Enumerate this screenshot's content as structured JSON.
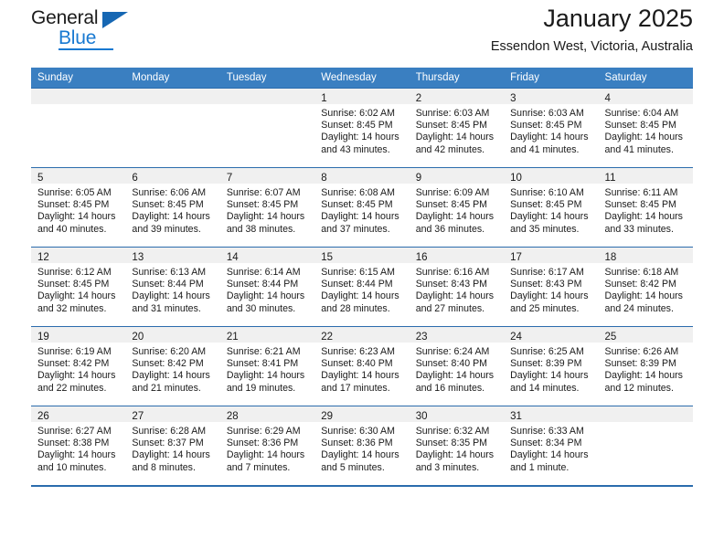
{
  "logo": {
    "word1": "General",
    "word2": "Blue",
    "triangle_color": "#1667b3",
    "blue_color": "#1879d1"
  },
  "header": {
    "title": "January 2025",
    "subtitle": "Essendon West, Victoria, Australia"
  },
  "theme": {
    "header_row_bg": "#3a7fc1",
    "row_divider": "#2b6cad",
    "daynum_band_bg": "#f0f0f0"
  },
  "calendar": {
    "day_headers": [
      "Sunday",
      "Monday",
      "Tuesday",
      "Wednesday",
      "Thursday",
      "Friday",
      "Saturday"
    ],
    "weeks": [
      [
        {
          "day": "",
          "sunrise": "",
          "sunset": "",
          "daylight1": "",
          "daylight2": "",
          "empty": true
        },
        {
          "day": "",
          "sunrise": "",
          "sunset": "",
          "daylight1": "",
          "daylight2": "",
          "empty": true
        },
        {
          "day": "",
          "sunrise": "",
          "sunset": "",
          "daylight1": "",
          "daylight2": "",
          "empty": true
        },
        {
          "day": "1",
          "sunrise": "Sunrise: 6:02 AM",
          "sunset": "Sunset: 8:45 PM",
          "daylight1": "Daylight: 14 hours",
          "daylight2": "and 43 minutes."
        },
        {
          "day": "2",
          "sunrise": "Sunrise: 6:03 AM",
          "sunset": "Sunset: 8:45 PM",
          "daylight1": "Daylight: 14 hours",
          "daylight2": "and 42 minutes."
        },
        {
          "day": "3",
          "sunrise": "Sunrise: 6:03 AM",
          "sunset": "Sunset: 8:45 PM",
          "daylight1": "Daylight: 14 hours",
          "daylight2": "and 41 minutes."
        },
        {
          "day": "4",
          "sunrise": "Sunrise: 6:04 AM",
          "sunset": "Sunset: 8:45 PM",
          "daylight1": "Daylight: 14 hours",
          "daylight2": "and 41 minutes."
        }
      ],
      [
        {
          "day": "5",
          "sunrise": "Sunrise: 6:05 AM",
          "sunset": "Sunset: 8:45 PM",
          "daylight1": "Daylight: 14 hours",
          "daylight2": "and 40 minutes."
        },
        {
          "day": "6",
          "sunrise": "Sunrise: 6:06 AM",
          "sunset": "Sunset: 8:45 PM",
          "daylight1": "Daylight: 14 hours",
          "daylight2": "and 39 minutes."
        },
        {
          "day": "7",
          "sunrise": "Sunrise: 6:07 AM",
          "sunset": "Sunset: 8:45 PM",
          "daylight1": "Daylight: 14 hours",
          "daylight2": "and 38 minutes."
        },
        {
          "day": "8",
          "sunrise": "Sunrise: 6:08 AM",
          "sunset": "Sunset: 8:45 PM",
          "daylight1": "Daylight: 14 hours",
          "daylight2": "and 37 minutes."
        },
        {
          "day": "9",
          "sunrise": "Sunrise: 6:09 AM",
          "sunset": "Sunset: 8:45 PM",
          "daylight1": "Daylight: 14 hours",
          "daylight2": "and 36 minutes."
        },
        {
          "day": "10",
          "sunrise": "Sunrise: 6:10 AM",
          "sunset": "Sunset: 8:45 PM",
          "daylight1": "Daylight: 14 hours",
          "daylight2": "and 35 minutes."
        },
        {
          "day": "11",
          "sunrise": "Sunrise: 6:11 AM",
          "sunset": "Sunset: 8:45 PM",
          "daylight1": "Daylight: 14 hours",
          "daylight2": "and 33 minutes."
        }
      ],
      [
        {
          "day": "12",
          "sunrise": "Sunrise: 6:12 AM",
          "sunset": "Sunset: 8:45 PM",
          "daylight1": "Daylight: 14 hours",
          "daylight2": "and 32 minutes."
        },
        {
          "day": "13",
          "sunrise": "Sunrise: 6:13 AM",
          "sunset": "Sunset: 8:44 PM",
          "daylight1": "Daylight: 14 hours",
          "daylight2": "and 31 minutes."
        },
        {
          "day": "14",
          "sunrise": "Sunrise: 6:14 AM",
          "sunset": "Sunset: 8:44 PM",
          "daylight1": "Daylight: 14 hours",
          "daylight2": "and 30 minutes."
        },
        {
          "day": "15",
          "sunrise": "Sunrise: 6:15 AM",
          "sunset": "Sunset: 8:44 PM",
          "daylight1": "Daylight: 14 hours",
          "daylight2": "and 28 minutes."
        },
        {
          "day": "16",
          "sunrise": "Sunrise: 6:16 AM",
          "sunset": "Sunset: 8:43 PM",
          "daylight1": "Daylight: 14 hours",
          "daylight2": "and 27 minutes."
        },
        {
          "day": "17",
          "sunrise": "Sunrise: 6:17 AM",
          "sunset": "Sunset: 8:43 PM",
          "daylight1": "Daylight: 14 hours",
          "daylight2": "and 25 minutes."
        },
        {
          "day": "18",
          "sunrise": "Sunrise: 6:18 AM",
          "sunset": "Sunset: 8:42 PM",
          "daylight1": "Daylight: 14 hours",
          "daylight2": "and 24 minutes."
        }
      ],
      [
        {
          "day": "19",
          "sunrise": "Sunrise: 6:19 AM",
          "sunset": "Sunset: 8:42 PM",
          "daylight1": "Daylight: 14 hours",
          "daylight2": "and 22 minutes."
        },
        {
          "day": "20",
          "sunrise": "Sunrise: 6:20 AM",
          "sunset": "Sunset: 8:42 PM",
          "daylight1": "Daylight: 14 hours",
          "daylight2": "and 21 minutes."
        },
        {
          "day": "21",
          "sunrise": "Sunrise: 6:21 AM",
          "sunset": "Sunset: 8:41 PM",
          "daylight1": "Daylight: 14 hours",
          "daylight2": "and 19 minutes."
        },
        {
          "day": "22",
          "sunrise": "Sunrise: 6:23 AM",
          "sunset": "Sunset: 8:40 PM",
          "daylight1": "Daylight: 14 hours",
          "daylight2": "and 17 minutes."
        },
        {
          "day": "23",
          "sunrise": "Sunrise: 6:24 AM",
          "sunset": "Sunset: 8:40 PM",
          "daylight1": "Daylight: 14 hours",
          "daylight2": "and 16 minutes."
        },
        {
          "day": "24",
          "sunrise": "Sunrise: 6:25 AM",
          "sunset": "Sunset: 8:39 PM",
          "daylight1": "Daylight: 14 hours",
          "daylight2": "and 14 minutes."
        },
        {
          "day": "25",
          "sunrise": "Sunrise: 6:26 AM",
          "sunset": "Sunset: 8:39 PM",
          "daylight1": "Daylight: 14 hours",
          "daylight2": "and 12 minutes."
        }
      ],
      [
        {
          "day": "26",
          "sunrise": "Sunrise: 6:27 AM",
          "sunset": "Sunset: 8:38 PM",
          "daylight1": "Daylight: 14 hours",
          "daylight2": "and 10 minutes."
        },
        {
          "day": "27",
          "sunrise": "Sunrise: 6:28 AM",
          "sunset": "Sunset: 8:37 PM",
          "daylight1": "Daylight: 14 hours",
          "daylight2": "and 8 minutes."
        },
        {
          "day": "28",
          "sunrise": "Sunrise: 6:29 AM",
          "sunset": "Sunset: 8:36 PM",
          "daylight1": "Daylight: 14 hours",
          "daylight2": "and 7 minutes."
        },
        {
          "day": "29",
          "sunrise": "Sunrise: 6:30 AM",
          "sunset": "Sunset: 8:36 PM",
          "daylight1": "Daylight: 14 hours",
          "daylight2": "and 5 minutes."
        },
        {
          "day": "30",
          "sunrise": "Sunrise: 6:32 AM",
          "sunset": "Sunset: 8:35 PM",
          "daylight1": "Daylight: 14 hours",
          "daylight2": "and 3 minutes."
        },
        {
          "day": "31",
          "sunrise": "Sunrise: 6:33 AM",
          "sunset": "Sunset: 8:34 PM",
          "daylight1": "Daylight: 14 hours",
          "daylight2": "and 1 minute."
        },
        {
          "day": "",
          "sunrise": "",
          "sunset": "",
          "daylight1": "",
          "daylight2": "",
          "empty": true
        }
      ]
    ]
  }
}
